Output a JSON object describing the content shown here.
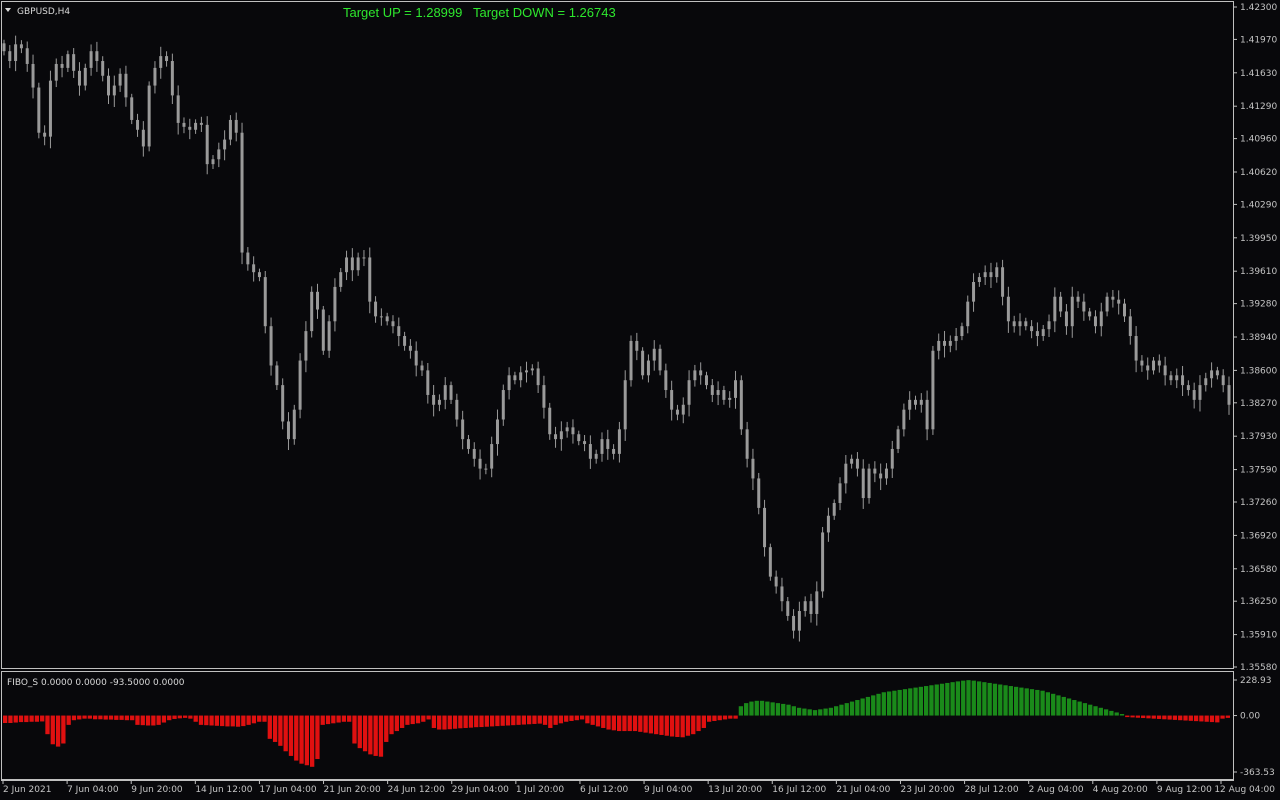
{
  "window": {
    "symbol_title": "GBPUSD,H4",
    "indicator_title": "FIBO_S 0.0000 0.0000 -93.5000 0.0000"
  },
  "targets": {
    "up_text": "Target UP = 1.28999",
    "down_text": "Target DOWN = 1.26743",
    "color": "#2ee82e"
  },
  "colors": {
    "background": "#08080b",
    "candle": "#9a9a9a",
    "frame": "#c0c0c0",
    "hist_positive": "#1a8a1a",
    "hist_negative": "#e01010",
    "label_text": "#c4c4c4"
  },
  "price_axis": {
    "labels": [
      "1.42300",
      "1.41970",
      "1.41630",
      "1.41290",
      "1.40960",
      "1.40620",
      "1.40290",
      "1.39950",
      "1.39610",
      "1.39280",
      "1.38940",
      "1.38600",
      "1.38270",
      "1.37930",
      "1.37590",
      "1.37260",
      "1.36920",
      "1.36580",
      "1.36250",
      "1.35910",
      "1.35580"
    ],
    "min": 1.3558,
    "max": 1.423
  },
  "indicator_axis": {
    "labels": [
      "228.93",
      "0.00",
      "-363.53"
    ],
    "min": -363.53,
    "max": 228.93
  },
  "time_axis": {
    "labels": [
      "2 Jun 2021",
      "7 Jun 04:00",
      "9 Jun 20:00",
      "14 Jun 12:00",
      "17 Jun 04:00",
      "21 Jun 20:00",
      "24 Jun 12:00",
      "29 Jun 04:00",
      "1 Jul 20:00",
      "6 Jul 12:00",
      "9 Jul 04:00",
      "13 Jul 20:00",
      "16 Jul 12:00",
      "21 Jul 04:00",
      "23 Jul 20:00",
      "28 Jul 12:00",
      "2 Aug 04:00",
      "4 Aug 20:00",
      "9 Aug 12:00",
      "12 Aug 04:00"
    ]
  },
  "chart_data": [
    {
      "type": "candlestick",
      "title": "GBPUSD,H4",
      "ylim": [
        1.3558,
        1.423
      ],
      "closes": [
        1.4185,
        1.4175,
        1.4192,
        1.4188,
        1.4172,
        1.4148,
        1.4102,
        1.4098,
        1.4155,
        1.4172,
        1.4168,
        1.4182,
        1.4165,
        1.415,
        1.4168,
        1.4185,
        1.4175,
        1.416,
        1.414,
        1.415,
        1.4162,
        1.4138,
        1.4115,
        1.4105,
        1.4088,
        1.415,
        1.4168,
        1.418,
        1.4175,
        1.414,
        1.4112,
        1.4108,
        1.4105,
        1.4112,
        1.411,
        1.407,
        1.4075,
        1.4085,
        1.4095,
        1.4115,
        1.4102,
        1.398,
        1.3968,
        1.396,
        1.3955,
        1.3905,
        1.3865,
        1.3845,
        1.3808,
        1.379,
        1.382,
        1.387,
        1.39,
        1.394,
        1.3922,
        1.388,
        1.391,
        1.3945,
        1.396,
        1.3975,
        1.3962,
        1.3975,
        1.3975,
        1.393,
        1.3915,
        1.3915,
        1.391,
        1.3905,
        1.3895,
        1.3885,
        1.388,
        1.3865,
        1.386,
        1.3835,
        1.3825,
        1.383,
        1.3845,
        1.383,
        1.381,
        1.379,
        1.378,
        1.377,
        1.376,
        1.376,
        1.3785,
        1.381,
        1.384,
        1.3855,
        1.385,
        1.3858,
        1.386,
        1.3862,
        1.3845,
        1.3822,
        1.3795,
        1.379,
        1.3798,
        1.3802,
        1.3795,
        1.3788,
        1.3785,
        1.377,
        1.3775,
        1.379,
        1.378,
        1.3775,
        1.38,
        1.385,
        1.389,
        1.388,
        1.3855,
        1.387,
        1.3882,
        1.386,
        1.384,
        1.382,
        1.3815,
        1.3825,
        1.385,
        1.386,
        1.3855,
        1.3845,
        1.3835,
        1.384,
        1.383,
        1.3832,
        1.385,
        1.38,
        1.377,
        1.375,
        1.372,
        1.368,
        1.365,
        1.364,
        1.3625,
        1.361,
        1.3595,
        1.3615,
        1.3625,
        1.3612,
        1.3635,
        1.3695,
        1.3712,
        1.3725,
        1.3745,
        1.3765,
        1.377,
        1.376,
        1.373,
        1.376,
        1.3755,
        1.375,
        1.376,
        1.378,
        1.38,
        1.382,
        1.383,
        1.3825,
        1.383,
        1.38,
        1.388,
        1.389,
        1.3885,
        1.389,
        1.3895,
        1.3905,
        1.393,
        1.395,
        1.3955,
        1.396,
        1.3955,
        1.3965,
        1.3935,
        1.391,
        1.3905,
        1.391,
        1.3905,
        1.39,
        1.3895,
        1.3902,
        1.391,
        1.3935,
        1.392,
        1.3905,
        1.3935,
        1.393,
        1.392,
        1.3915,
        1.3905,
        1.392,
        1.3935,
        1.3932,
        1.3928,
        1.3915,
        1.3895,
        1.387,
        1.3865,
        1.386,
        1.387,
        1.3865,
        1.3855,
        1.385,
        1.3855,
        1.3845,
        1.384,
        1.383,
        1.3845,
        1.3852,
        1.386,
        1.3855,
        1.3845,
        1.3825
      ]
    },
    {
      "type": "bar",
      "title": "FIBO_S 0.0000 0.0000 -93.5000 0.0000",
      "ylim": [
        -363.53,
        228.93
      ],
      "values": [
        -48,
        -48,
        -45,
        -42,
        -42,
        -40,
        -40,
        -38,
        -120,
        -185,
        -200,
        -180,
        -60,
        -30,
        -25,
        -20,
        -20,
        -24,
        -24,
        -26,
        -26,
        -28,
        -28,
        -30,
        -30,
        -60,
        -62,
        -64,
        -64,
        -60,
        -45,
        -30,
        -22,
        -18,
        -15,
        -20,
        -40,
        -60,
        -62,
        -64,
        -66,
        -68,
        -70,
        -70,
        -72,
        -68,
        -60,
        -50,
        -40,
        -40,
        -150,
        -170,
        -195,
        -230,
        -260,
        -290,
        -310,
        -320,
        -330,
        -280,
        -60,
        -55,
        -50,
        -45,
        -40,
        -40,
        -180,
        -210,
        -230,
        -250,
        -260,
        -265,
        -170,
        -120,
        -100,
        -80,
        -60,
        -55,
        -50,
        -40,
        -25,
        -80,
        -90,
        -90,
        -88,
        -85,
        -82,
        -80,
        -78,
        -75,
        -74,
        -72,
        -70,
        -68,
        -66,
        -64,
        -62,
        -60,
        -58,
        -56,
        -54,
        -52,
        -60,
        -80,
        -60,
        -50,
        -40,
        -35,
        -30,
        -25,
        -50,
        -60,
        -70,
        -80,
        -90,
        -95,
        -100,
        -100,
        -100,
        -100,
        -105,
        -110,
        -115,
        -120,
        -125,
        -130,
        -135,
        -138,
        -140,
        -130,
        -120,
        -100,
        -80,
        -40,
        -35,
        -30,
        -25,
        -20,
        -20,
        60,
        80,
        90,
        95,
        95,
        90,
        85,
        80,
        75,
        70,
        60,
        50,
        45,
        40,
        35,
        40,
        45,
        50,
        60,
        70,
        80,
        90,
        100,
        110,
        120,
        130,
        140,
        150,
        155,
        160,
        165,
        170,
        175,
        180,
        185,
        190,
        195,
        200,
        205,
        210,
        215,
        220,
        225,
        228,
        225,
        220,
        215,
        210,
        205,
        200,
        195,
        190,
        185,
        180,
        175,
        170,
        165,
        160,
        150,
        140,
        130,
        120,
        110,
        100,
        90,
        80,
        70,
        60,
        50,
        40,
        30,
        20,
        10,
        -10,
        -12,
        -14,
        -16,
        -18,
        -20,
        -22,
        -24,
        -26,
        -28,
        -30,
        -32,
        -34,
        -36,
        -38,
        -40,
        -42,
        -44,
        -20,
        -15
      ]
    }
  ]
}
